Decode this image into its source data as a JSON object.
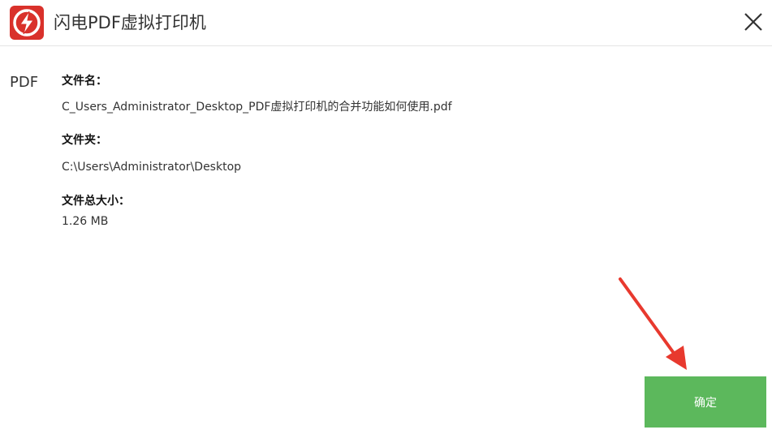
{
  "window": {
    "title": "闪电PDF虚拟打印机",
    "logo_icon": "lightning-logo-icon",
    "close_icon": "close-icon",
    "brand_color": "#d9312b"
  },
  "file": {
    "type_label": "PDF",
    "name_label": "文件名：",
    "name_value": "C_Users_Administrator_Desktop_PDF虚拟打印机的合并功能如何使用.pdf",
    "folder_label": "文件夹：",
    "folder_value": "C:\\Users\\Administrator\\Desktop",
    "size_label": "文件总大小：",
    "size_value": "1.26 MB"
  },
  "actions": {
    "confirm_label": "确定",
    "confirm_color": "#5cb85c"
  },
  "annotation": {
    "arrow_icon": "red-arrow-icon",
    "color": "#e8392e"
  }
}
